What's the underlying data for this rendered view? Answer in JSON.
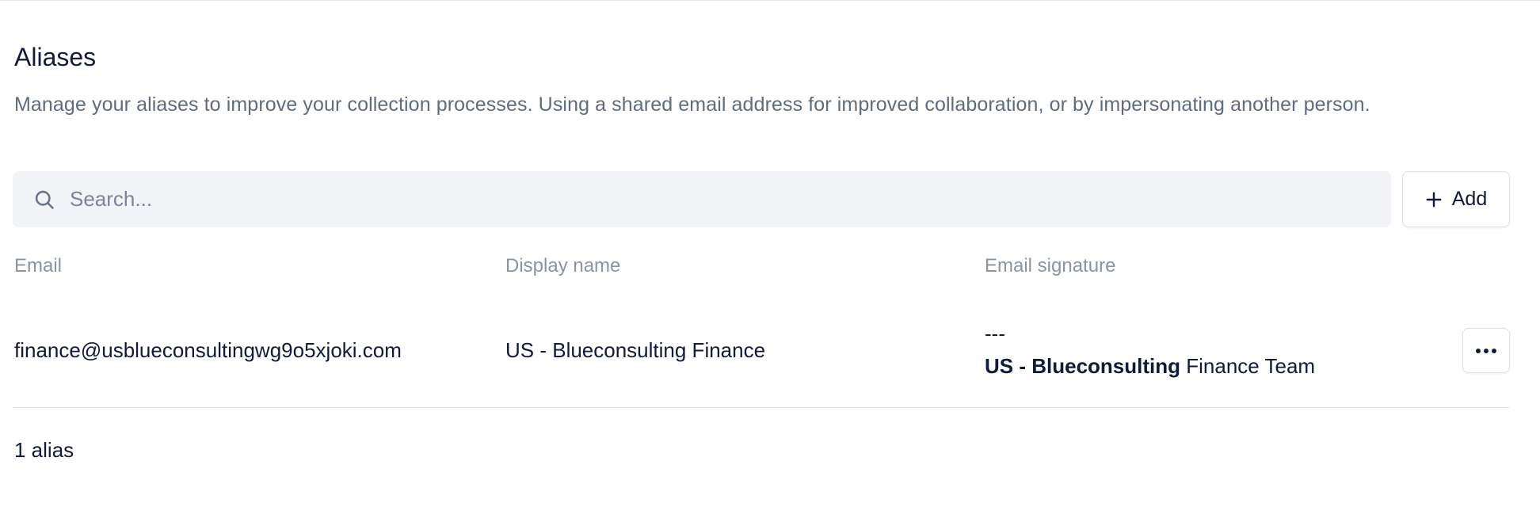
{
  "page": {
    "title": "Aliases",
    "description": "Manage your aliases to improve your collection processes. Using a shared email address for improved collaboration, or by impersonating another person."
  },
  "search": {
    "placeholder": "Search...",
    "value": "",
    "icon": "search-icon"
  },
  "toolbar": {
    "add_label": "Add",
    "add_icon": "plus-icon"
  },
  "table": {
    "columns": [
      "Email",
      "Display name",
      "Email signature"
    ],
    "rows": [
      {
        "email": "finance@usblueconsultingwg9o5xjoki.com",
        "display_name": "US - Blueconsulting Finance",
        "signature": {
          "dashes": "---",
          "bold_text": "US - Blueconsulting",
          "rest_text": "Finance Team"
        },
        "actions_icon": "more-horizontal-icon"
      }
    ]
  },
  "footer": {
    "count_label": "1 alias"
  },
  "colors": {
    "text_primary": "#101b3b",
    "text_secondary": "#5f6b80",
    "text_muted": "#8a93a5",
    "search_bg": "#f3f4f7",
    "border": "#dde0e6"
  }
}
